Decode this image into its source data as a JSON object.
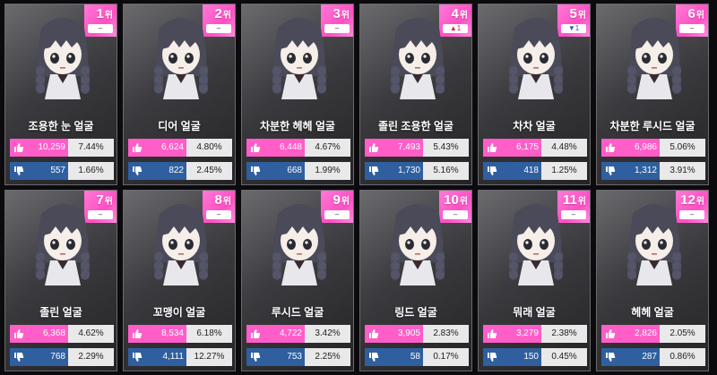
{
  "rank_suffix": "위",
  "cards": [
    {
      "rank": "1",
      "change": "–",
      "change_dir": "none",
      "name": "조용한 눈 얼굴",
      "likes": "10,259",
      "like_pct": "7.44%",
      "dislikes": "557",
      "dislike_pct": "1.66%"
    },
    {
      "rank": "2",
      "change": "–",
      "change_dir": "none",
      "name": "디어 얼굴",
      "likes": "6,624",
      "like_pct": "4.80%",
      "dislikes": "822",
      "dislike_pct": "2.45%"
    },
    {
      "rank": "3",
      "change": "–",
      "change_dir": "none",
      "name": "차분한 헤헤 얼굴",
      "likes": "6,448",
      "like_pct": "4.67%",
      "dislikes": "668",
      "dislike_pct": "1.99%"
    },
    {
      "rank": "4",
      "change": "▲1",
      "change_dir": "up",
      "name": "졸린 조용한 얼굴",
      "likes": "7,493",
      "like_pct": "5.43%",
      "dislikes": "1,730",
      "dislike_pct": "5.16%"
    },
    {
      "rank": "5",
      "change": "▼1",
      "change_dir": "down",
      "name": "차차 얼굴",
      "likes": "6,175",
      "like_pct": "4.48%",
      "dislikes": "418",
      "dislike_pct": "1.25%"
    },
    {
      "rank": "6",
      "change": "–",
      "change_dir": "none",
      "name": "차분한 루시드 얼굴",
      "likes": "6,986",
      "like_pct": "5.06%",
      "dislikes": "1,312",
      "dislike_pct": "3.91%"
    },
    {
      "rank": "7",
      "change": "–",
      "change_dir": "none",
      "name": "졸린 얼굴",
      "likes": "6,368",
      "like_pct": "4.62%",
      "dislikes": "768",
      "dislike_pct": "2.29%"
    },
    {
      "rank": "8",
      "change": "–",
      "change_dir": "none",
      "name": "꼬맹이 얼굴",
      "likes": "8,534",
      "like_pct": "6.18%",
      "dislikes": "4,111",
      "dislike_pct": "12.27%"
    },
    {
      "rank": "9",
      "change": "–",
      "change_dir": "none",
      "name": "루시드 얼굴",
      "likes": "4,722",
      "like_pct": "3.42%",
      "dislikes": "753",
      "dislike_pct": "2.25%"
    },
    {
      "rank": "10",
      "change": "–",
      "change_dir": "none",
      "name": "링드 얼굴",
      "likes": "3,905",
      "like_pct": "2.83%",
      "dislikes": "58",
      "dislike_pct": "0.17%"
    },
    {
      "rank": "11",
      "change": "–",
      "change_dir": "none",
      "name": "뭐래 얼굴",
      "likes": "3,279",
      "like_pct": "2.38%",
      "dislikes": "150",
      "dislike_pct": "0.45%"
    },
    {
      "rank": "12",
      "change": "–",
      "change_dir": "none",
      "name": "헤헤 얼굴",
      "likes": "2,826",
      "like_pct": "2.05%",
      "dislikes": "287",
      "dislike_pct": "0.86%"
    }
  ],
  "colors": {
    "like": "#ff5dc8",
    "dislike": "#2f5f9e",
    "badge": "#ff5fcc",
    "hair": "#4a4a58"
  },
  "icons": {
    "like": "thumbs-up-icon",
    "dislike": "thumbs-down-icon"
  }
}
